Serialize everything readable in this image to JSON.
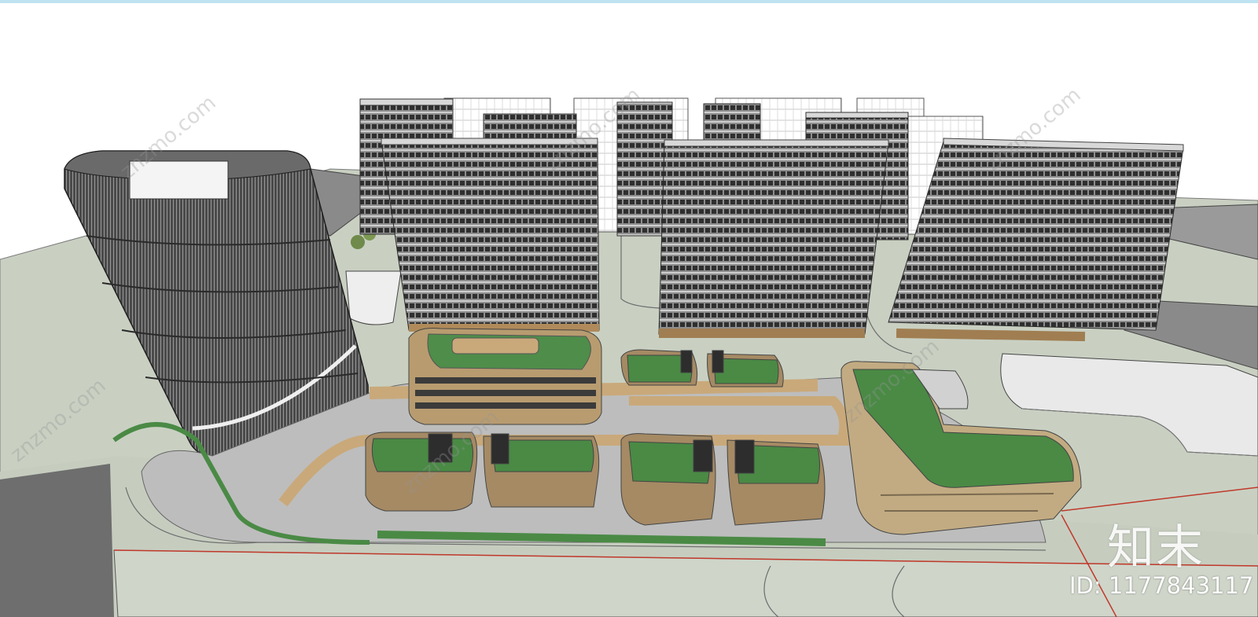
{
  "watermark": {
    "site": "znzmo.com",
    "brand": "知末",
    "id_label": "ID: 1177843117"
  },
  "colors": {
    "sky": "#ffffff",
    "ground": "#c9d0c2",
    "road": "#bcbcbc",
    "podium_wood": "#c9a97a",
    "roof_green": "#4a8a45",
    "tower_dark": "#3d3d3d",
    "slab_grey": "#8c8c8c"
  }
}
